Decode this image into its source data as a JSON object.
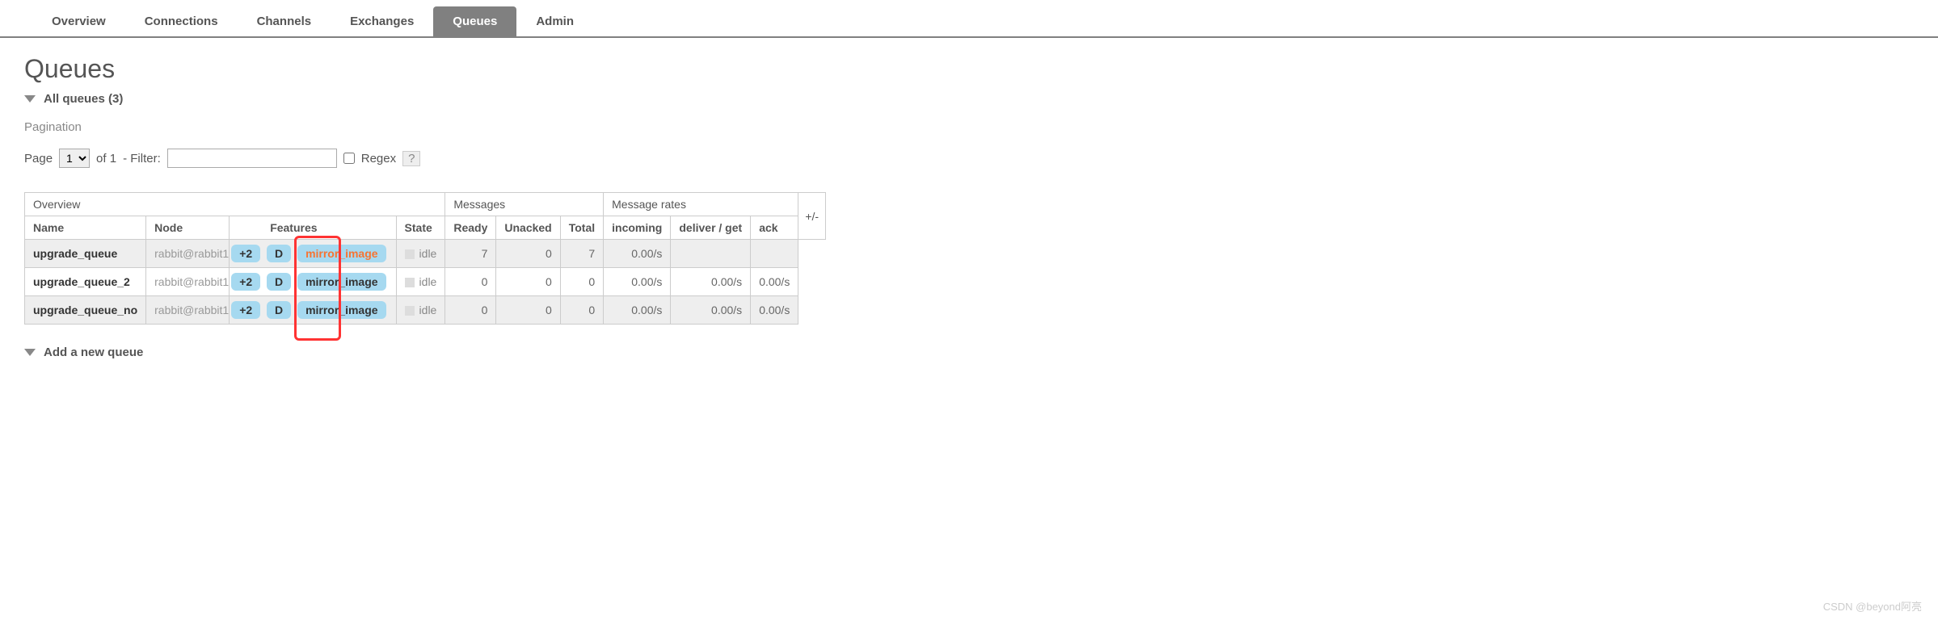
{
  "tabs": {
    "overview": "Overview",
    "connections": "Connections",
    "channels": "Channels",
    "exchanges": "Exchanges",
    "queues": "Queues",
    "admin": "Admin"
  },
  "page_title": "Queues",
  "all_queues_label": "All queues (3)",
  "pagination_label": "Pagination",
  "page_word": "Page",
  "page_of": "of 1",
  "filter_label": "- Filter:",
  "regex_label": "Regex",
  "regex_help": "?",
  "page_select": "1",
  "plusminus": "+/-",
  "headers": {
    "overview": "Overview",
    "messages": "Messages",
    "message_rates": "Message rates",
    "name": "Name",
    "node": "Node",
    "features": "Features",
    "state": "State",
    "ready": "Ready",
    "unacked": "Unacked",
    "total": "Total",
    "incoming": "incoming",
    "deliver_get": "deliver / get",
    "ack": "ack"
  },
  "rows": [
    {
      "name": "upgrade_queue",
      "node": "rabbit@rabbit1",
      "plus": "+2",
      "d": "D",
      "mirror": "mirror_image",
      "mirror_orange": true,
      "state": "idle",
      "ready": "7",
      "unacked": "0",
      "total": "7",
      "incoming": "0.00/s",
      "deliver": "",
      "ack": "",
      "highlight": true
    },
    {
      "name": "upgrade_queue_2",
      "node": "rabbit@rabbit1",
      "plus": "+2",
      "d": "D",
      "mirror": "mirror_image",
      "mirror_orange": false,
      "state": "idle",
      "ready": "0",
      "unacked": "0",
      "total": "0",
      "incoming": "0.00/s",
      "deliver": "0.00/s",
      "ack": "0.00/s",
      "highlight": false
    },
    {
      "name": "upgrade_queue_no",
      "node": "rabbit@rabbit1",
      "plus": "+2",
      "d": "D",
      "mirror": "mirror_image",
      "mirror_orange": false,
      "state": "idle",
      "ready": "0",
      "unacked": "0",
      "total": "0",
      "incoming": "0.00/s",
      "deliver": "0.00/s",
      "ack": "0.00/s",
      "highlight": true
    }
  ],
  "add_queue_label": "Add a new queue",
  "watermark": "CSDN @beyond阿亮"
}
